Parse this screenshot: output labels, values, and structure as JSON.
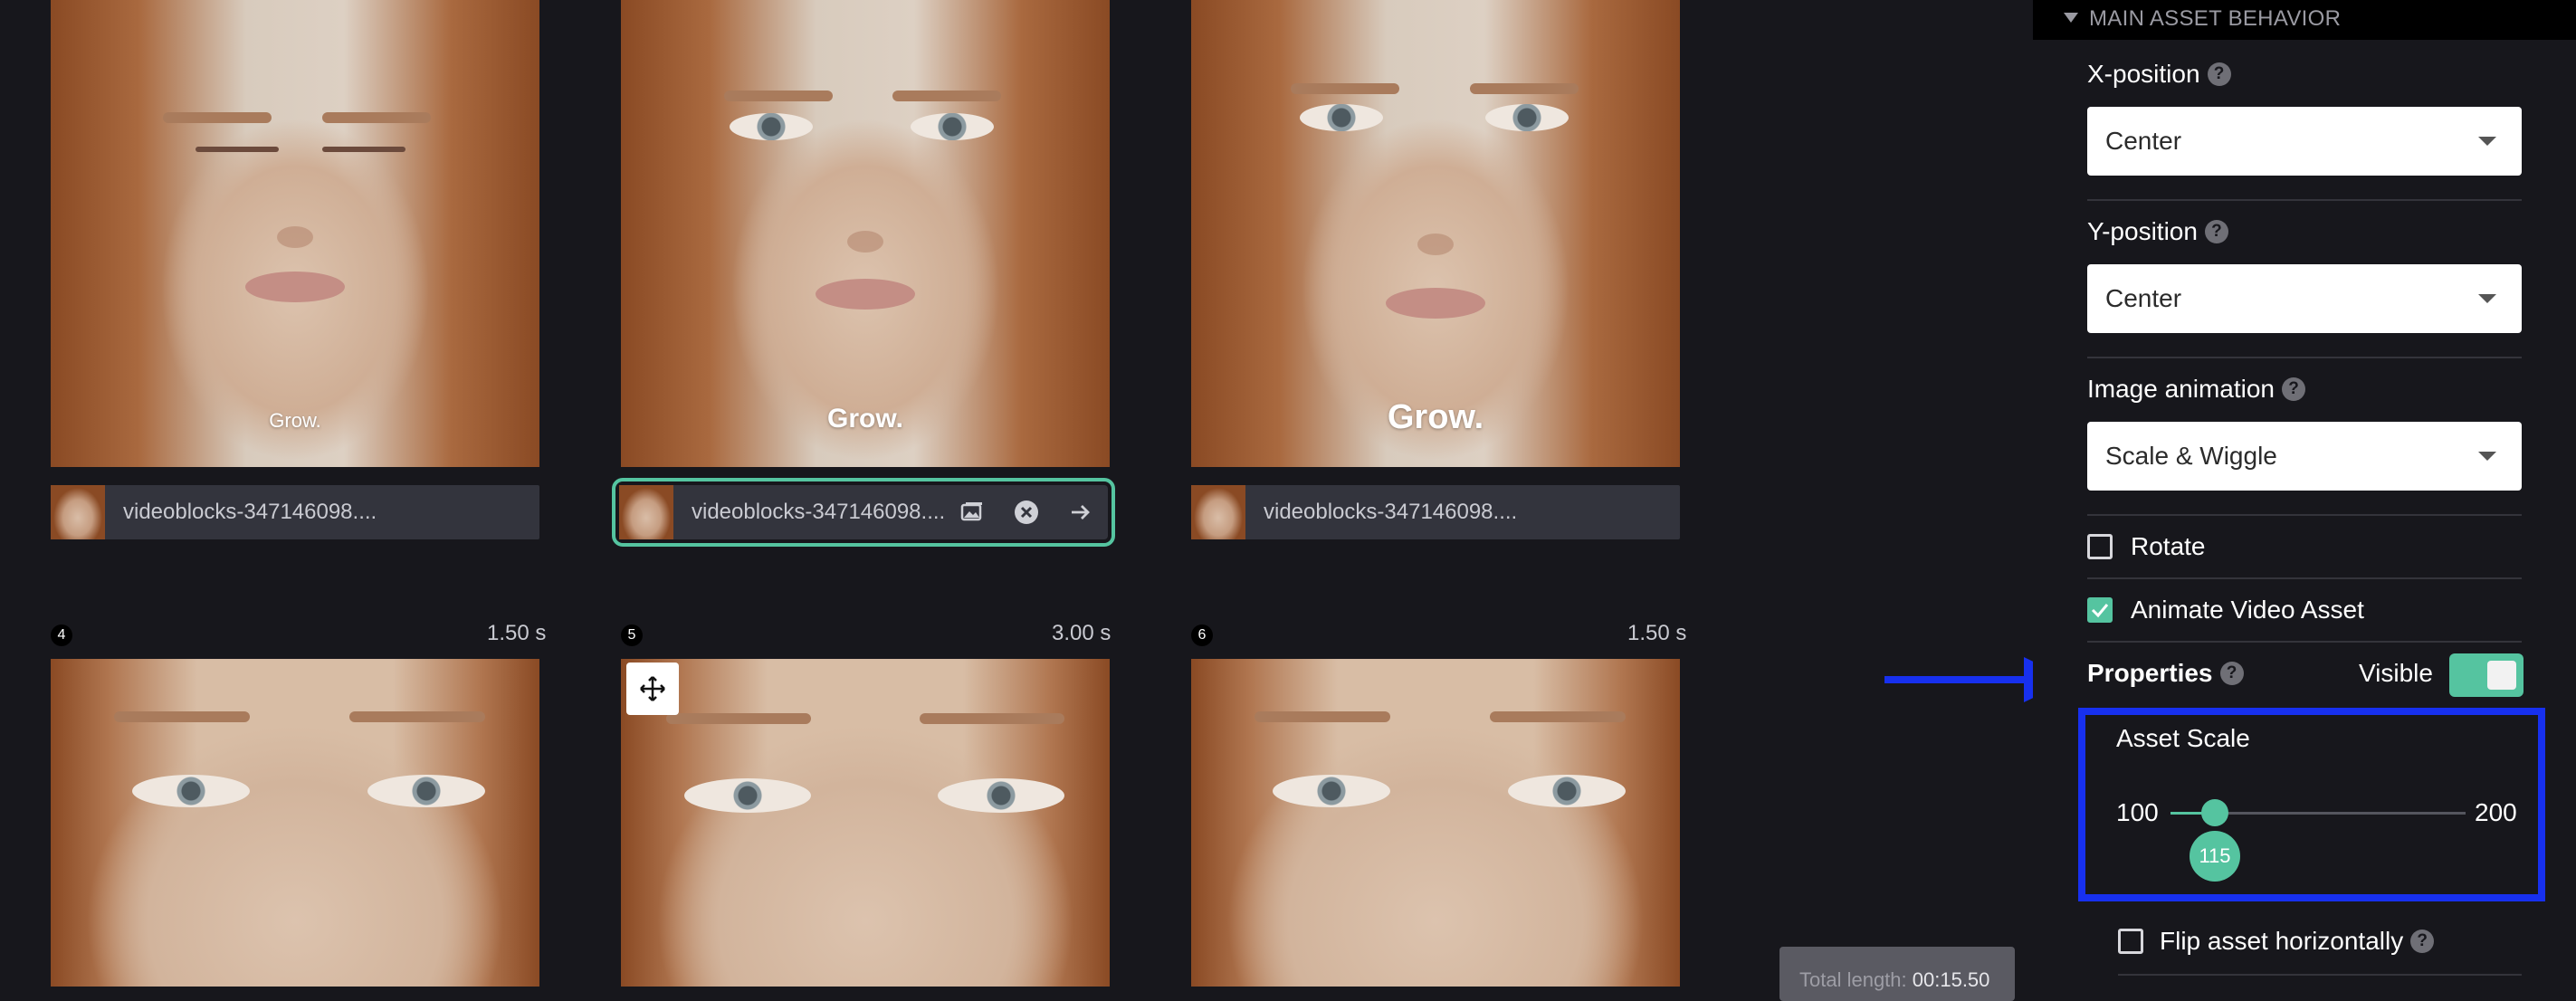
{
  "tiles_top": [
    {
      "overlay": "Grow.",
      "filename": "videoblocks-347146098...."
    },
    {
      "overlay": "Grow.",
      "filename": "videoblocks-347146098...."
    },
    {
      "overlay": "Grow.",
      "filename": "videoblocks-347146098...."
    }
  ],
  "tiles_bottom": [
    {
      "number": "4",
      "duration": "1.50 s"
    },
    {
      "number": "5",
      "duration": "3.00 s"
    },
    {
      "number": "6",
      "duration": "1.50 s"
    }
  ],
  "total_length": {
    "label": "Total length:",
    "value": "00:15.50"
  },
  "panel": {
    "section_title": "MAIN ASSET BEHAVIOR",
    "help_glyph": "?",
    "x_position": {
      "label": "X-position",
      "value": "Center"
    },
    "y_position": {
      "label": "Y-position",
      "value": "Center"
    },
    "image_animation": {
      "label": "Image animation",
      "value": "Scale & Wiggle"
    },
    "rotate": {
      "label": "Rotate",
      "checked": false
    },
    "animate_video": {
      "label": "Animate Video Asset",
      "checked": true
    },
    "properties": {
      "label": "Properties",
      "visible_label": "Visible",
      "visible_on": true
    },
    "asset_scale": {
      "label": "Asset Scale",
      "min": "100",
      "max": "200",
      "value": "115"
    },
    "flip_horizontal": {
      "label": "Flip asset horizontally",
      "checked": false
    }
  },
  "colors": {
    "accent": "#55c4a0",
    "annotation": "#1730ef",
    "background": "#17171c"
  },
  "icons": [
    "image-icon",
    "close-circle-icon",
    "arrow-right-icon",
    "move-icon",
    "help-icon",
    "chevron-down-icon",
    "check-icon"
  ]
}
